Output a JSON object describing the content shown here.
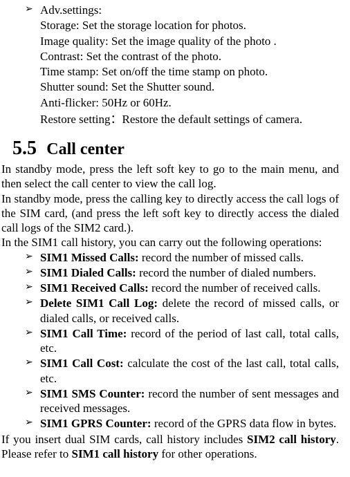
{
  "adv": {
    "heading": "Adv.settings:",
    "storage": "Storage: Set the storage location for photos.",
    "image_quality": "Image quality: Set the image quality of the photo .",
    "contrast": "Contrast: Set the contrast of the photo.",
    "time_stamp": "Time stamp: Set on/off the time stamp on photo.",
    "shutter": "Shutter sound: Set the Shutter sound.",
    "anti_flicker": "Anti-flicker: 50Hz or 60Hz.",
    "restore": "Restore setting：Restore the default settings of camera."
  },
  "section": {
    "number": "5.5",
    "title": "Call center"
  },
  "paras": {
    "p1": "In standby mode, press the left soft key to go to the main menu, and then select the call center to view the call log.",
    "p2": "In standby mode, press the calling key to directly access the call logs of the SIM card, (and press the left soft key to directly access the dialed call logs of the SIM2 card.).",
    "p3": "In the SIM1 call history, you can carry out the following operations:"
  },
  "ops": {
    "missed_b": "SIM1 Missed Calls: ",
    "missed_t": "record the number of missed calls.",
    "dialed_b": "SIM1 Dialed Calls: ",
    "dialed_t": "record the number of dialed numbers.",
    "received_b": "SIM1 Received Calls: ",
    "received_t": "record the number of received calls.",
    "delete_b": "Delete SIM1 Call Log: ",
    "delete_t": "delete the record of missed calls, or dialed calls, or received calls.",
    "time_b": "SIM1 Call Time: ",
    "time_t": "record of the period of last call, total calls, etc.",
    "cost_b": "SIM1 Call Cost: ",
    "cost_t": "calculate the cost of the last call, total calls, etc.",
    "sms_b": "SIM1 SMS Counter: ",
    "sms_t": "record the number of sent messages and received messages.",
    "gprs_b": "SIM1 GPRS Counter: ",
    "gprs_t": "record of the GPRS data flow in bytes."
  },
  "footer": {
    "pre": "If you insert dual SIM cards, call history includes ",
    "b1": "SIM2 call history",
    "mid": ". Please refer to ",
    "b2": "SIM1 call history",
    "post": " for other operations."
  }
}
